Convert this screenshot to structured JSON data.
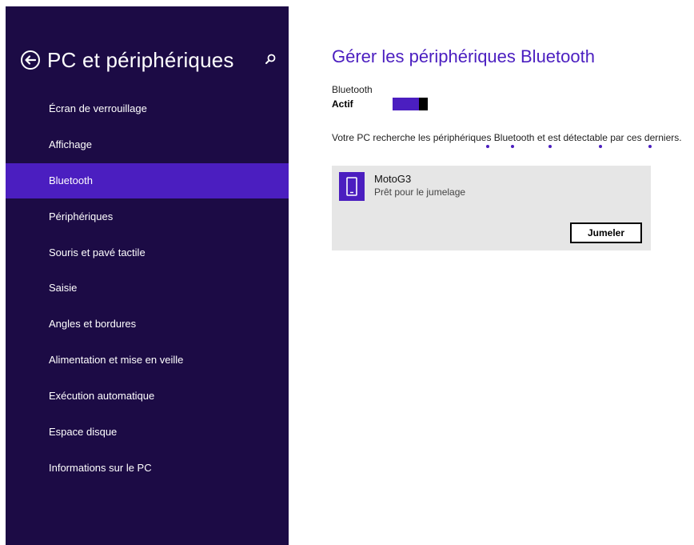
{
  "sidebar": {
    "title": "PC et périphériques",
    "back_icon": "back-arrow-icon",
    "search_icon": "search-icon",
    "items": [
      {
        "label": "Écran de verrouillage",
        "selected": false
      },
      {
        "label": "Affichage",
        "selected": false
      },
      {
        "label": "Bluetooth",
        "selected": true
      },
      {
        "label": "Périphériques",
        "selected": false
      },
      {
        "label": "Souris et pavé tactile",
        "selected": false
      },
      {
        "label": "Saisie",
        "selected": false
      },
      {
        "label": "Angles et bordures",
        "selected": false
      },
      {
        "label": "Alimentation et mise en veille",
        "selected": false
      },
      {
        "label": "Exécution automatique",
        "selected": false
      },
      {
        "label": "Espace disque",
        "selected": false
      },
      {
        "label": "Informations sur le PC",
        "selected": false
      }
    ]
  },
  "main": {
    "title": "Gérer les périphériques Bluetooth",
    "bluetooth_toggle": {
      "label": "Bluetooth",
      "state": "Actif",
      "on": true
    },
    "status": "Votre PC recherche les périphériques Bluetooth et est détectable par ces derniers.",
    "devices": [
      {
        "name": "MotoG3",
        "status": "Prêt pour le jumelage",
        "icon": "phone-icon",
        "action": "Jumeler"
      }
    ]
  },
  "colors": {
    "sidebar_bg": "#1c0b45",
    "accent": "#4b1ec0",
    "card_bg": "#e6e6e6"
  }
}
